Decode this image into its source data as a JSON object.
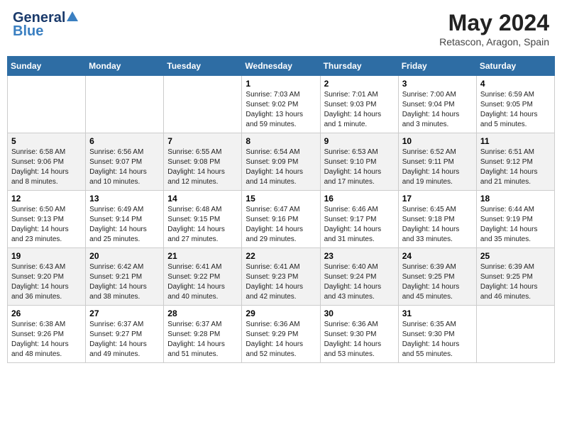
{
  "header": {
    "logo_general": "General",
    "logo_blue": "Blue",
    "month_title": "May 2024",
    "location": "Retascon, Aragon, Spain"
  },
  "days_of_week": [
    "Sunday",
    "Monday",
    "Tuesday",
    "Wednesday",
    "Thursday",
    "Friday",
    "Saturday"
  ],
  "weeks": [
    {
      "days": [
        {
          "num": "",
          "info": ""
        },
        {
          "num": "",
          "info": ""
        },
        {
          "num": "",
          "info": ""
        },
        {
          "num": "1",
          "info": "Sunrise: 7:03 AM\nSunset: 9:02 PM\nDaylight: 13 hours and 59 minutes."
        },
        {
          "num": "2",
          "info": "Sunrise: 7:01 AM\nSunset: 9:03 PM\nDaylight: 14 hours and 1 minute."
        },
        {
          "num": "3",
          "info": "Sunrise: 7:00 AM\nSunset: 9:04 PM\nDaylight: 14 hours and 3 minutes."
        },
        {
          "num": "4",
          "info": "Sunrise: 6:59 AM\nSunset: 9:05 PM\nDaylight: 14 hours and 5 minutes."
        }
      ]
    },
    {
      "days": [
        {
          "num": "5",
          "info": "Sunrise: 6:58 AM\nSunset: 9:06 PM\nDaylight: 14 hours and 8 minutes."
        },
        {
          "num": "6",
          "info": "Sunrise: 6:56 AM\nSunset: 9:07 PM\nDaylight: 14 hours and 10 minutes."
        },
        {
          "num": "7",
          "info": "Sunrise: 6:55 AM\nSunset: 9:08 PM\nDaylight: 14 hours and 12 minutes."
        },
        {
          "num": "8",
          "info": "Sunrise: 6:54 AM\nSunset: 9:09 PM\nDaylight: 14 hours and 14 minutes."
        },
        {
          "num": "9",
          "info": "Sunrise: 6:53 AM\nSunset: 9:10 PM\nDaylight: 14 hours and 17 minutes."
        },
        {
          "num": "10",
          "info": "Sunrise: 6:52 AM\nSunset: 9:11 PM\nDaylight: 14 hours and 19 minutes."
        },
        {
          "num": "11",
          "info": "Sunrise: 6:51 AM\nSunset: 9:12 PM\nDaylight: 14 hours and 21 minutes."
        }
      ]
    },
    {
      "days": [
        {
          "num": "12",
          "info": "Sunrise: 6:50 AM\nSunset: 9:13 PM\nDaylight: 14 hours and 23 minutes."
        },
        {
          "num": "13",
          "info": "Sunrise: 6:49 AM\nSunset: 9:14 PM\nDaylight: 14 hours and 25 minutes."
        },
        {
          "num": "14",
          "info": "Sunrise: 6:48 AM\nSunset: 9:15 PM\nDaylight: 14 hours and 27 minutes."
        },
        {
          "num": "15",
          "info": "Sunrise: 6:47 AM\nSunset: 9:16 PM\nDaylight: 14 hours and 29 minutes."
        },
        {
          "num": "16",
          "info": "Sunrise: 6:46 AM\nSunset: 9:17 PM\nDaylight: 14 hours and 31 minutes."
        },
        {
          "num": "17",
          "info": "Sunrise: 6:45 AM\nSunset: 9:18 PM\nDaylight: 14 hours and 33 minutes."
        },
        {
          "num": "18",
          "info": "Sunrise: 6:44 AM\nSunset: 9:19 PM\nDaylight: 14 hours and 35 minutes."
        }
      ]
    },
    {
      "days": [
        {
          "num": "19",
          "info": "Sunrise: 6:43 AM\nSunset: 9:20 PM\nDaylight: 14 hours and 36 minutes."
        },
        {
          "num": "20",
          "info": "Sunrise: 6:42 AM\nSunset: 9:21 PM\nDaylight: 14 hours and 38 minutes."
        },
        {
          "num": "21",
          "info": "Sunrise: 6:41 AM\nSunset: 9:22 PM\nDaylight: 14 hours and 40 minutes."
        },
        {
          "num": "22",
          "info": "Sunrise: 6:41 AM\nSunset: 9:23 PM\nDaylight: 14 hours and 42 minutes."
        },
        {
          "num": "23",
          "info": "Sunrise: 6:40 AM\nSunset: 9:24 PM\nDaylight: 14 hours and 43 minutes."
        },
        {
          "num": "24",
          "info": "Sunrise: 6:39 AM\nSunset: 9:25 PM\nDaylight: 14 hours and 45 minutes."
        },
        {
          "num": "25",
          "info": "Sunrise: 6:39 AM\nSunset: 9:25 PM\nDaylight: 14 hours and 46 minutes."
        }
      ]
    },
    {
      "days": [
        {
          "num": "26",
          "info": "Sunrise: 6:38 AM\nSunset: 9:26 PM\nDaylight: 14 hours and 48 minutes."
        },
        {
          "num": "27",
          "info": "Sunrise: 6:37 AM\nSunset: 9:27 PM\nDaylight: 14 hours and 49 minutes."
        },
        {
          "num": "28",
          "info": "Sunrise: 6:37 AM\nSunset: 9:28 PM\nDaylight: 14 hours and 51 minutes."
        },
        {
          "num": "29",
          "info": "Sunrise: 6:36 AM\nSunset: 9:29 PM\nDaylight: 14 hours and 52 minutes."
        },
        {
          "num": "30",
          "info": "Sunrise: 6:36 AM\nSunset: 9:30 PM\nDaylight: 14 hours and 53 minutes."
        },
        {
          "num": "31",
          "info": "Sunrise: 6:35 AM\nSunset: 9:30 PM\nDaylight: 14 hours and 55 minutes."
        },
        {
          "num": "",
          "info": ""
        }
      ]
    }
  ]
}
